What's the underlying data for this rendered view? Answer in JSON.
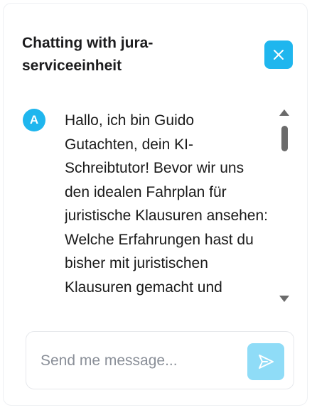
{
  "header": {
    "title": "Chatting with jura-serviceeinheit"
  },
  "icons": {
    "close": "close-icon",
    "send": "send-icon"
  },
  "messages": [
    {
      "avatar_letter": "A",
      "text": "Hallo, ich bin Guido Gutachten, dein KI-Schreibtutor! Bevor wir uns den idealen Fahrplan für juristische Klausuren ansehen: Welche Erfahrungen hast du bisher mit juristischen Klausuren gemacht und"
    }
  ],
  "composer": {
    "placeholder": "Send me message..."
  },
  "colors": {
    "accent": "#1fb6ee",
    "send_button": "#8fdcf7",
    "text": "#1a1a1a",
    "placeholder": "#8a8f98"
  }
}
